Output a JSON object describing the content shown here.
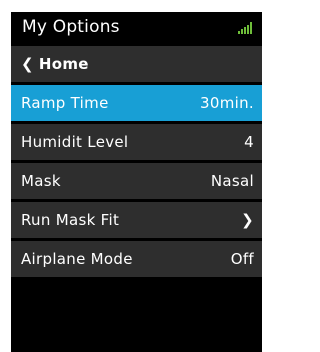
{
  "header": {
    "title": "My Options",
    "signal_icon": "signal-bars-icon",
    "signal_color": "#6fbe3a"
  },
  "menu": {
    "back": {
      "icon": "chevron-left-icon",
      "label": "Home"
    },
    "items": [
      {
        "label": "Ramp Time",
        "value": "30min.",
        "selected": true
      },
      {
        "label": "Humidit Level",
        "value": "4"
      },
      {
        "label": "Mask",
        "value": "Nasal"
      },
      {
        "label": "Run Mask Fit",
        "icon": "chevron-right-icon"
      },
      {
        "label": "Airplane Mode",
        "value": "Off"
      }
    ]
  },
  "colors": {
    "selected_row": "#189fd5",
    "row_background": "#2e2e2e",
    "screen_background": "#000000"
  }
}
